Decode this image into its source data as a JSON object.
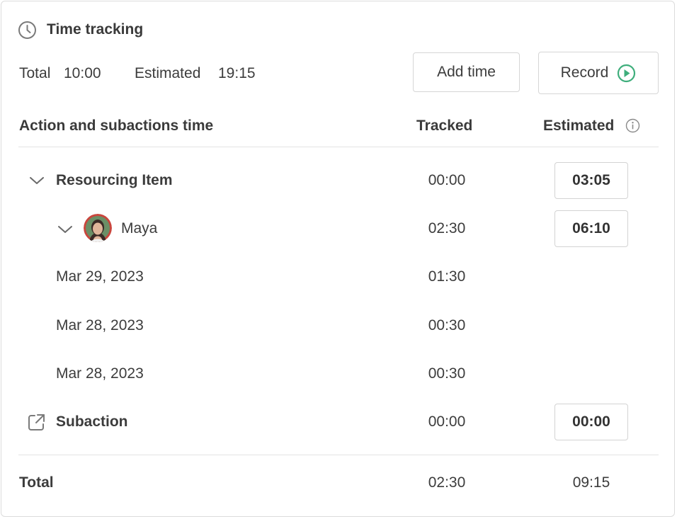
{
  "header": {
    "title": "Time tracking",
    "total_label": "Total",
    "total_value": "10:00",
    "estimated_label": "Estimated",
    "estimated_value": "19:15",
    "add_time_label": "Add time",
    "record_label": "Record"
  },
  "table": {
    "col_name": "Action and subactions time",
    "col_tracked": "Tracked",
    "col_estimated": "Estimated"
  },
  "rows": {
    "resourcing": {
      "label": "Resourcing Item",
      "tracked": "00:00",
      "estimated": "03:05"
    },
    "maya": {
      "label": "Maya",
      "tracked": "02:30",
      "estimated": "06:10"
    },
    "entries": [
      {
        "date": "Mar 29, 2023",
        "tracked": "01:30"
      },
      {
        "date": "Mar 28, 2023",
        "tracked": "00:30"
      },
      {
        "date": "Mar 28, 2023",
        "tracked": "00:30"
      }
    ],
    "subaction": {
      "label": "Subaction",
      "tracked": "00:00",
      "estimated": "00:00"
    }
  },
  "footer": {
    "total_label": "Total",
    "tracked": "02:30",
    "estimated": "09:15"
  },
  "colors": {
    "record_icon": "#3fae7c",
    "text": "#3c3c3c",
    "border": "#d6d6d6"
  }
}
